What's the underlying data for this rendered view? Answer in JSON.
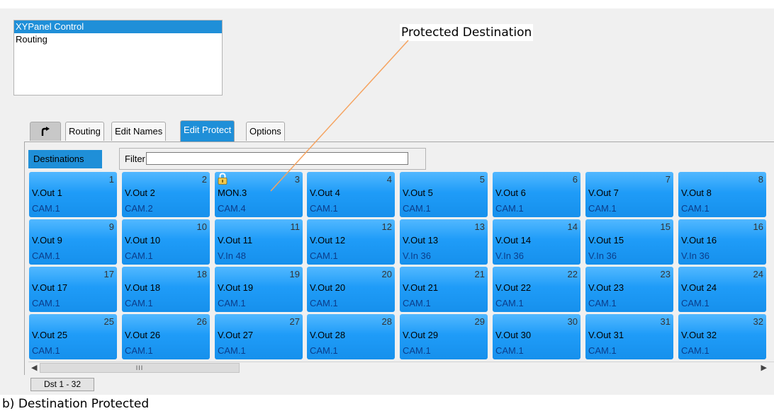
{
  "nav": {
    "items": [
      {
        "label": "XYPanel Control",
        "selected": true
      },
      {
        "label": "Routing",
        "selected": false
      }
    ]
  },
  "callout": {
    "label": "Protected Destination"
  },
  "tabs": {
    "back_icon": "back-arrow-icon",
    "items": [
      "Routing",
      "Edit Names",
      "Edit Protect",
      "Options"
    ],
    "active": "Edit Protect"
  },
  "destinations": {
    "label": "Destinations",
    "filter_label": "Filter:",
    "filter_value": "",
    "tiles": [
      {
        "num": "1",
        "name": "V.Out 1",
        "src": "CAM.1",
        "locked": false
      },
      {
        "num": "2",
        "name": "V.Out 2",
        "src": "CAM.2",
        "locked": false
      },
      {
        "num": "3",
        "name": "MON.3",
        "src": "CAM.4",
        "locked": true
      },
      {
        "num": "4",
        "name": "V.Out 4",
        "src": "CAM.1",
        "locked": false
      },
      {
        "num": "5",
        "name": "V.Out 5",
        "src": "CAM.1",
        "locked": false
      },
      {
        "num": "6",
        "name": "V.Out 6",
        "src": "CAM.1",
        "locked": false
      },
      {
        "num": "7",
        "name": "V.Out 7",
        "src": "CAM.1",
        "locked": false
      },
      {
        "num": "8",
        "name": "V.Out 8",
        "src": "CAM.1",
        "locked": false
      },
      {
        "num": "9",
        "name": "V.Out 9",
        "src": "CAM.1",
        "locked": false
      },
      {
        "num": "10",
        "name": "V.Out 10",
        "src": "CAM.1",
        "locked": false
      },
      {
        "num": "11",
        "name": "V.Out 11",
        "src": "V.In 48",
        "locked": false
      },
      {
        "num": "12",
        "name": "V.Out 12",
        "src": "CAM.1",
        "locked": false
      },
      {
        "num": "13",
        "name": "V.Out 13",
        "src": "V.In 36",
        "locked": false
      },
      {
        "num": "14",
        "name": "V.Out 14",
        "src": "V.In 36",
        "locked": false
      },
      {
        "num": "15",
        "name": "V.Out 15",
        "src": "V.In 36",
        "locked": false
      },
      {
        "num": "16",
        "name": "V.Out 16",
        "src": "V.In 36",
        "locked": false
      },
      {
        "num": "17",
        "name": "V.Out 17",
        "src": "CAM.1",
        "locked": false
      },
      {
        "num": "18",
        "name": "V.Out 18",
        "src": "CAM.1",
        "locked": false
      },
      {
        "num": "19",
        "name": "V.Out 19",
        "src": "CAM.1",
        "locked": false
      },
      {
        "num": "20",
        "name": "V.Out 20",
        "src": "CAM.1",
        "locked": false
      },
      {
        "num": "21",
        "name": "V.Out 21",
        "src": "CAM.1",
        "locked": false
      },
      {
        "num": "22",
        "name": "V.Out 22",
        "src": "CAM.1",
        "locked": false
      },
      {
        "num": "23",
        "name": "V.Out 23",
        "src": "CAM.1",
        "locked": false
      },
      {
        "num": "24",
        "name": "V.Out 24",
        "src": "CAM.1",
        "locked": false
      },
      {
        "num": "25",
        "name": "V.Out 25",
        "src": "CAM.1",
        "locked": false
      },
      {
        "num": "26",
        "name": "V.Out 26",
        "src": "CAM.1",
        "locked": false
      },
      {
        "num": "27",
        "name": "V.Out 27",
        "src": "CAM.1",
        "locked": false
      },
      {
        "num": "28",
        "name": "V.Out 28",
        "src": "CAM.1",
        "locked": false
      },
      {
        "num": "29",
        "name": "V.Out 29",
        "src": "CAM.1",
        "locked": false
      },
      {
        "num": "30",
        "name": "V.Out 30",
        "src": "CAM.1",
        "locked": false
      },
      {
        "num": "31",
        "name": "V.Out 31",
        "src": "CAM.1",
        "locked": false
      },
      {
        "num": "32",
        "name": "V.Out 32",
        "src": "CAM.1",
        "locked": false
      }
    ]
  },
  "scrollbar": {
    "left_glyph": "◀",
    "right_glyph": "▶",
    "thumb_grip": "III"
  },
  "pager": {
    "label": "Dst 1 - 32"
  },
  "caption": "b) Destination Protected",
  "colors": {
    "accent": "#1f8fd8",
    "tile_top": "#52b8ff",
    "tile_bottom": "#1690ec",
    "lock": "#f2c94c"
  }
}
